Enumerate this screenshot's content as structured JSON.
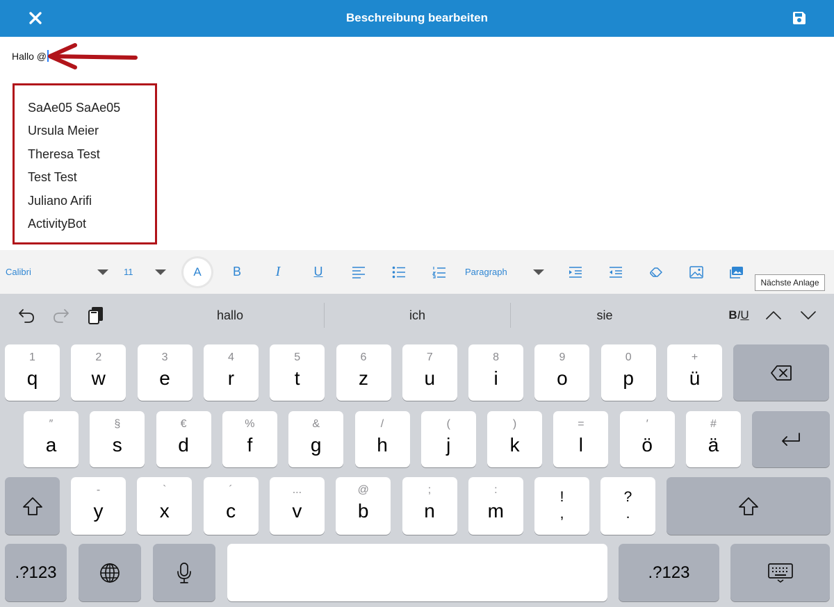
{
  "header": {
    "title": "Beschreibung bearbeiten",
    "close_icon": "close-icon",
    "save_icon": "save-icon"
  },
  "editor": {
    "text": "Hallo @",
    "mention_suggestions": [
      "SaAe05 SaAe05",
      "Ursula Meier",
      "Theresa Test",
      "Test Test",
      "Juliano Arifi",
      "ActivityBot"
    ],
    "annotation_color": "#b1141a"
  },
  "format_toolbar": {
    "font": "Calibri",
    "size": "11",
    "text_color_label": "A",
    "bold": "B",
    "italic": "I",
    "underline": "U",
    "block_format": "Paragraph",
    "tooltip": "Nächste Anlage"
  },
  "keyboard": {
    "suggestions": [
      "hallo",
      "ich",
      "sie"
    ],
    "biu": "BIU",
    "row1": [
      {
        "sub": "1",
        "main": "q"
      },
      {
        "sub": "2",
        "main": "w"
      },
      {
        "sub": "3",
        "main": "e"
      },
      {
        "sub": "4",
        "main": "r"
      },
      {
        "sub": "5",
        "main": "t"
      },
      {
        "sub": "6",
        "main": "z"
      },
      {
        "sub": "7",
        "main": "u"
      },
      {
        "sub": "8",
        "main": "i"
      },
      {
        "sub": "9",
        "main": "o"
      },
      {
        "sub": "0",
        "main": "p"
      },
      {
        "sub": "+",
        "main": "ü"
      }
    ],
    "row2": [
      {
        "sub": "″",
        "main": "a"
      },
      {
        "sub": "§",
        "main": "s"
      },
      {
        "sub": "€",
        "main": "d"
      },
      {
        "sub": "%",
        "main": "f"
      },
      {
        "sub": "&",
        "main": "g"
      },
      {
        "sub": "/",
        "main": "h"
      },
      {
        "sub": "(",
        "main": "j"
      },
      {
        "sub": ")",
        "main": "k"
      },
      {
        "sub": "=",
        "main": "l"
      },
      {
        "sub": "′",
        "main": "ö"
      },
      {
        "sub": "#",
        "main": "ä"
      }
    ],
    "row3": [
      {
        "sub": "-",
        "main": "y"
      },
      {
        "sub": "`",
        "main": "x"
      },
      {
        "sub": "´",
        "main": "c"
      },
      {
        "sub": "...",
        "main": "v"
      },
      {
        "sub": "@",
        "main": "b"
      },
      {
        "sub": ";",
        "main": "n"
      },
      {
        "sub": ":",
        "main": "m"
      }
    ],
    "punct1": {
      "top": "!",
      "bottom": ","
    },
    "punct2": {
      "top": "?",
      "bottom": "."
    },
    "numbers_label": ".?123"
  },
  "colors": {
    "accent": "#1e88cf",
    "toolbar_icon": "#2f86d3",
    "keyboard_bg": "#d1d4d9"
  }
}
